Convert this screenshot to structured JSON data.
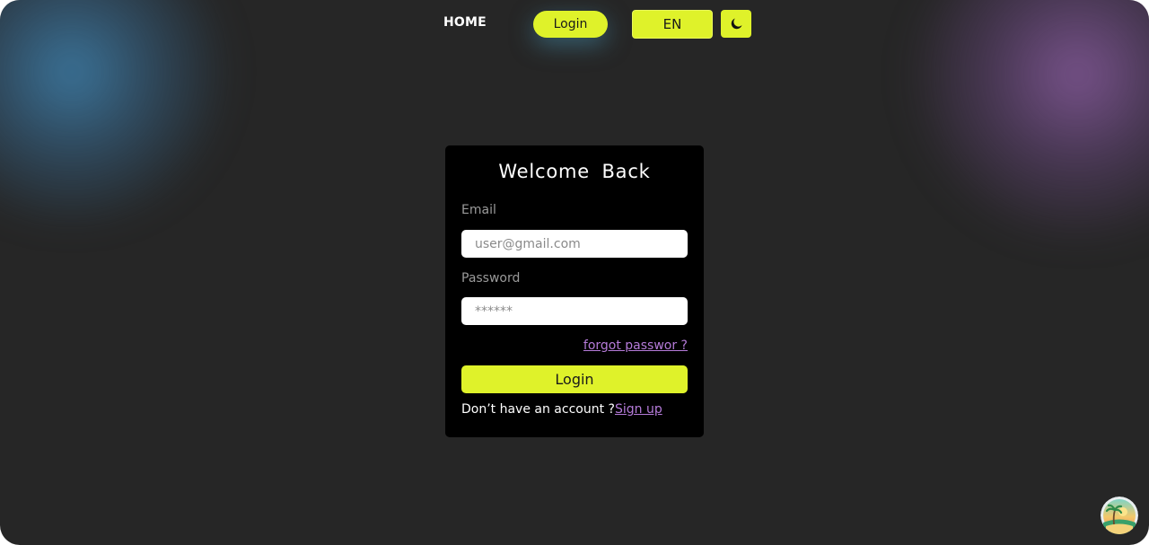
{
  "nav": {
    "home_label": "HOME",
    "login_label": "Login",
    "language_label": "EN",
    "theme_icon": "moon-icon"
  },
  "login_card": {
    "title": "Welcome  Back",
    "email_label": "Email",
    "email_placeholder": "user@gmail.com",
    "password_label": "Password",
    "password_placeholder": "******",
    "forgot_link": "forgot passwor ?",
    "submit_label": "Login",
    "signup_prompt": "Don’t have an account ?",
    "signup_link": "Sign up"
  },
  "corner_badge_icon": "island-palm-icon",
  "colors": {
    "background": "#262626",
    "accent": "#dff22a",
    "card": "#000000",
    "link": "#b57bd9"
  }
}
